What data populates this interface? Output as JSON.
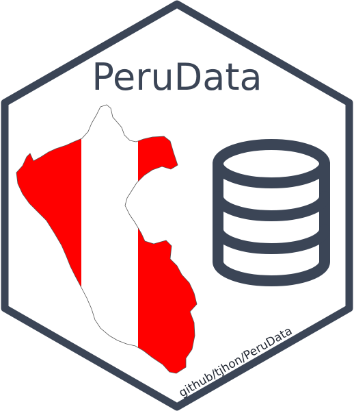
{
  "logo": {
    "title": "PeruData",
    "url": "github/tjhon/PeruData",
    "colors": {
      "border": "#3b4556",
      "flag_red": "#ff0000",
      "flag_white": "#ffffff",
      "map_outline": "#555555",
      "background": "#ffffff"
    },
    "icons": {
      "map": "peru-map-flag-icon",
      "database": "database-icon"
    }
  }
}
